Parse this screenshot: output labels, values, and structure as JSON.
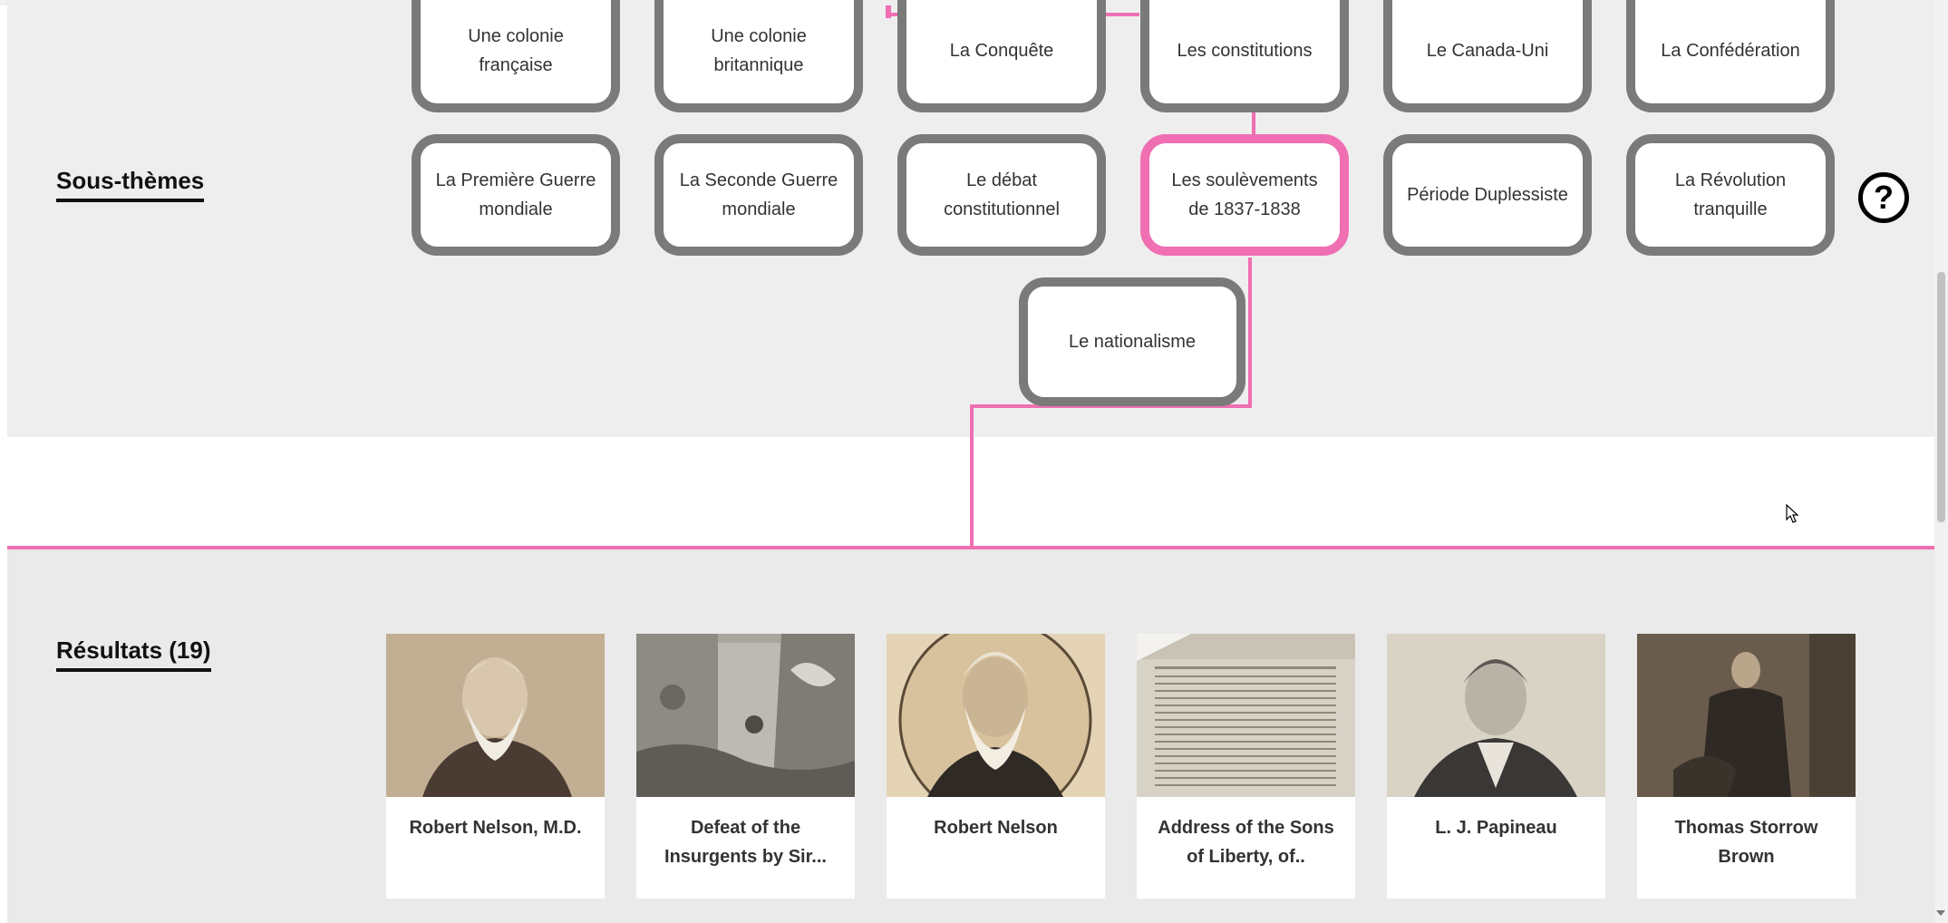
{
  "subthemes": {
    "title": "Sous-thèmes",
    "row1": [
      "Une colonie française",
      "Une colonie britannique",
      "La Conquête",
      "Les constitutions",
      "Le Canada-Uni",
      "La Confédération"
    ],
    "row2": [
      "La Première Guerre mondiale",
      "La Seconde Guerre mondiale",
      "Le débat constitutionnel",
      "Les soulèvements de 1837-1838",
      "Période Duplessiste",
      "La Révolution tranquille"
    ],
    "row3": [
      "Le nationalisme"
    ],
    "active": "Les soulèvements de 1837-1838"
  },
  "help": {
    "icon": "question-circle-icon",
    "symbol": "?"
  },
  "results": {
    "title": "Résultats (19)",
    "items": [
      {
        "caption": "Robert Nelson, M.D.",
        "image": "portrait-photo"
      },
      {
        "caption": "Defeat of the Insurgents by Sir...",
        "image": "engraving-scene"
      },
      {
        "caption": "Robert Nelson",
        "image": "oval-engraved-portrait"
      },
      {
        "caption": "Address of the Sons of Liberty, of..",
        "image": "printed-document"
      },
      {
        "caption": "L. J. Papineau",
        "image": "lithograph-portrait"
      },
      {
        "caption": "Thomas Storrow Brown",
        "image": "standing-man-photo"
      }
    ]
  },
  "colors": {
    "accent": "#ef6fb2",
    "tile_border": "#7a7a7a",
    "band": "#eeeeee"
  }
}
